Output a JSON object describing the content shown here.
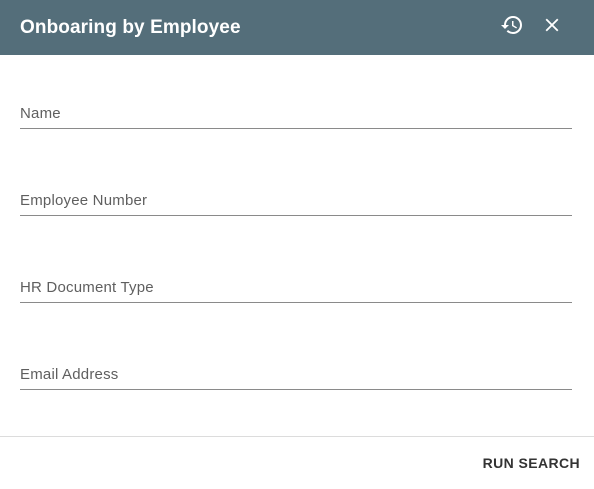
{
  "dialog": {
    "title": "Onboaring by Employee",
    "history_icon": "history-icon",
    "close_icon": "close-icon"
  },
  "form": {
    "fields": [
      {
        "label": "Name"
      },
      {
        "label": "Employee Number"
      },
      {
        "label": "HR Document Type"
      },
      {
        "label": "Email Address"
      }
    ]
  },
  "footer": {
    "run_search_label": "RUN SEARCH"
  },
  "colors": {
    "header_bg": "#546e7a",
    "header_text": "#ffffff",
    "field_underline": "#8a8a8a",
    "label_text": "#5f5f5f",
    "button_text": "#333333"
  }
}
